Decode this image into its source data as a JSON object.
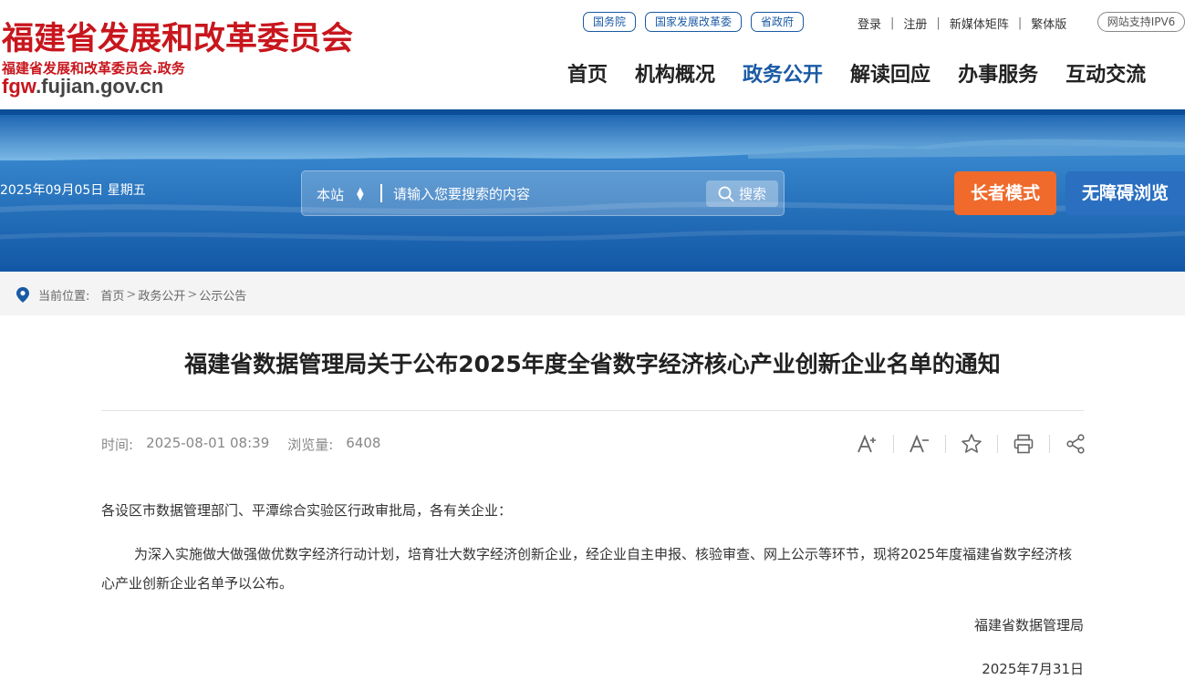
{
  "header": {
    "logo_title": "福建省发展和改革委员会",
    "logo_subtitle": "福建省发展和改革委员会.政务",
    "logo_domain_accent": "fgw",
    "logo_domain_rest": ".fujian.gov.cn",
    "pills": [
      "国务院",
      "国家发展改革委",
      "省政府"
    ],
    "links": [
      "登录",
      "注册",
      "新媒体矩阵",
      "繁体版"
    ],
    "ipv6_label": "网站支持IPV6",
    "nav": [
      "首页",
      "机构概况",
      "政务公开",
      "解读回应",
      "办事服务",
      "互动交流"
    ],
    "nav_active": "政务公开"
  },
  "banner": {
    "date": "2025年09月05日 星期五",
    "search_scope": "本站",
    "search_placeholder": "请输入您要搜索的内容",
    "search_button": "搜索",
    "elder_mode": "长者模式",
    "accessibility": "无障碍浏览"
  },
  "breadcrumb": {
    "label": "当前位置:",
    "items": [
      "首页",
      "政务公开",
      "公示公告"
    ]
  },
  "article": {
    "title": "福建省数据管理局关于公布2025年度全省数字经济核心产业创新企业名单的通知",
    "time_label": "时间:",
    "time_value": "2025-08-01 08:39",
    "views_label": "浏览量:",
    "views_value": "6408",
    "tools": [
      "font-increase-icon",
      "font-decrease-icon",
      "star-icon",
      "print-icon",
      "share-icon"
    ],
    "salutation": "各设区市数据管理部门、平潭综合实验区行政审批局，各有关企业：",
    "body": "为深入实施做大做强做优数字经济行动计划，培育壮大数字经济创新企业，经企业自主申报、核验审查、网上公示等环节，现将2025年度福建省数字经济核心产业创新企业名单予以公布。",
    "signature": "福建省数据管理局",
    "sign_date": "2025年7月31日"
  },
  "colors": {
    "brand_red": "#c8161d",
    "nav_blue": "#1a5aa5",
    "elder_orange": "#ef6a2b",
    "access_blue": "#2a6fc0"
  }
}
